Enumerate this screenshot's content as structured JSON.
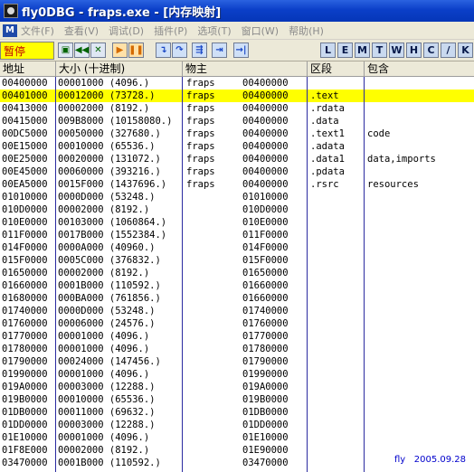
{
  "window": {
    "title": "fly0DBG - fraps.exe - [内存映射]"
  },
  "menu": {
    "mdi_label": "M",
    "items": [
      "文件(F)",
      "查看(V)",
      "调试(D)",
      "插件(P)",
      "选项(T)",
      "窗口(W)",
      "帮助(H)"
    ]
  },
  "toolbar": {
    "status": "暂停",
    "buttons": [
      {
        "icon": "open-folder-icon",
        "glyph": "▣",
        "style": "green"
      },
      {
        "icon": "rewind-icon",
        "glyph": "◀◀",
        "style": "green"
      },
      {
        "icon": "close-x-icon",
        "glyph": "✕",
        "style": "green"
      },
      {
        "icon": "run-icon",
        "glyph": "▶",
        "style": "orange"
      },
      {
        "icon": "pause-icon",
        "glyph": "❚❚",
        "style": "orange"
      },
      {
        "icon": "step-into-icon",
        "glyph": "↴",
        "style": "blue"
      },
      {
        "icon": "step-over-icon",
        "glyph": "↷",
        "style": "blue"
      },
      {
        "icon": "trace-into-icon",
        "glyph": "⇶",
        "style": "blue"
      },
      {
        "icon": "trace-over-icon",
        "glyph": "⇥",
        "style": "blue"
      },
      {
        "icon": "execute-till-return-icon",
        "glyph": "→|",
        "style": "blue"
      }
    ],
    "letters": [
      "L",
      "E",
      "M",
      "T",
      "W",
      "H",
      "C",
      "/",
      "K"
    ]
  },
  "table": {
    "headers": {
      "address": "地址",
      "size": "大小    (十进制)",
      "owner": "物主",
      "section": "区段",
      "contains": "包含"
    },
    "selected_index": 1,
    "rows": [
      {
        "address": "00400000",
        "size": "00001000 (4096.)",
        "owner": "fraps",
        "base": "00400000",
        "section": "",
        "contains": ""
      },
      {
        "address": "00401000",
        "size": "00012000 (73728.)",
        "owner": "fraps",
        "base": "00400000",
        "section": ".text",
        "contains": ""
      },
      {
        "address": "00413000",
        "size": "00002000 (8192.)",
        "owner": "fraps",
        "base": "00400000",
        "section": ".rdata",
        "contains": ""
      },
      {
        "address": "00415000",
        "size": "009B8000 (10158080.)",
        "owner": "fraps",
        "base": "00400000",
        "section": ".data",
        "contains": ""
      },
      {
        "address": "00DC5000",
        "size": "00050000 (327680.)",
        "owner": "fraps",
        "base": "00400000",
        "section": ".text1",
        "contains": "code"
      },
      {
        "address": "00E15000",
        "size": "00010000 (65536.)",
        "owner": "fraps",
        "base": "00400000",
        "section": ".adata",
        "contains": ""
      },
      {
        "address": "00E25000",
        "size": "00020000 (131072.)",
        "owner": "fraps",
        "base": "00400000",
        "section": ".data1",
        "contains": "data,imports"
      },
      {
        "address": "00E45000",
        "size": "00060000 (393216.)",
        "owner": "fraps",
        "base": "00400000",
        "section": ".pdata",
        "contains": ""
      },
      {
        "address": "00EA5000",
        "size": "0015F000 (1437696.)",
        "owner": "fraps",
        "base": "00400000",
        "section": ".rsrc",
        "contains": "resources"
      },
      {
        "address": "01010000",
        "size": "0000D000 (53248.)",
        "owner": "",
        "base": "01010000",
        "section": "",
        "contains": ""
      },
      {
        "address": "010D0000",
        "size": "00002000 (8192.)",
        "owner": "",
        "base": "010D0000",
        "section": "",
        "contains": ""
      },
      {
        "address": "010E0000",
        "size": "00103000 (1060864.)",
        "owner": "",
        "base": "010E0000",
        "section": "",
        "contains": ""
      },
      {
        "address": "011F0000",
        "size": "0017B000 (1552384.)",
        "owner": "",
        "base": "011F0000",
        "section": "",
        "contains": ""
      },
      {
        "address": "014F0000",
        "size": "0000A000 (40960.)",
        "owner": "",
        "base": "014F0000",
        "section": "",
        "contains": ""
      },
      {
        "address": "015F0000",
        "size": "0005C000 (376832.)",
        "owner": "",
        "base": "015F0000",
        "section": "",
        "contains": ""
      },
      {
        "address": "01650000",
        "size": "00002000 (8192.)",
        "owner": "",
        "base": "01650000",
        "section": "",
        "contains": ""
      },
      {
        "address": "01660000",
        "size": "0001B000 (110592.)",
        "owner": "",
        "base": "01660000",
        "section": "",
        "contains": ""
      },
      {
        "address": "01680000",
        "size": "000BA000 (761856.)",
        "owner": "",
        "base": "01660000",
        "section": "",
        "contains": ""
      },
      {
        "address": "01740000",
        "size": "0000D000 (53248.)",
        "owner": "",
        "base": "01740000",
        "section": "",
        "contains": ""
      },
      {
        "address": "01760000",
        "size": "00006000 (24576.)",
        "owner": "",
        "base": "01760000",
        "section": "",
        "contains": ""
      },
      {
        "address": "01770000",
        "size": "00001000 (4096.)",
        "owner": "",
        "base": "01770000",
        "section": "",
        "contains": ""
      },
      {
        "address": "01780000",
        "size": "00001000 (4096.)",
        "owner": "",
        "base": "01780000",
        "section": "",
        "contains": ""
      },
      {
        "address": "01790000",
        "size": "00024000 (147456.)",
        "owner": "",
        "base": "01790000",
        "section": "",
        "contains": ""
      },
      {
        "address": "01990000",
        "size": "00001000 (4096.)",
        "owner": "",
        "base": "01990000",
        "section": "",
        "contains": ""
      },
      {
        "address": "019A0000",
        "size": "00003000 (12288.)",
        "owner": "",
        "base": "019A0000",
        "section": "",
        "contains": ""
      },
      {
        "address": "019B0000",
        "size": "00010000 (65536.)",
        "owner": "",
        "base": "019B0000",
        "section": "",
        "contains": ""
      },
      {
        "address": "01DB0000",
        "size": "00011000 (69632.)",
        "owner": "",
        "base": "01DB0000",
        "section": "",
        "contains": ""
      },
      {
        "address": "01DD0000",
        "size": "00003000 (12288.)",
        "owner": "",
        "base": "01DD0000",
        "section": "",
        "contains": ""
      },
      {
        "address": "01E10000",
        "size": "00001000 (4096.)",
        "owner": "",
        "base": "01E10000",
        "section": "",
        "contains": ""
      },
      {
        "address": "01F8E000",
        "size": "00002000 (8192.)",
        "owner": "",
        "base": "01E90000",
        "section": "",
        "contains": ""
      },
      {
        "address": "03470000",
        "size": "0001B000 (110592.)",
        "owner": "",
        "base": "03470000",
        "section": "",
        "contains": ""
      }
    ]
  },
  "signature": {
    "author": "fly",
    "date": "2005.09.28"
  }
}
